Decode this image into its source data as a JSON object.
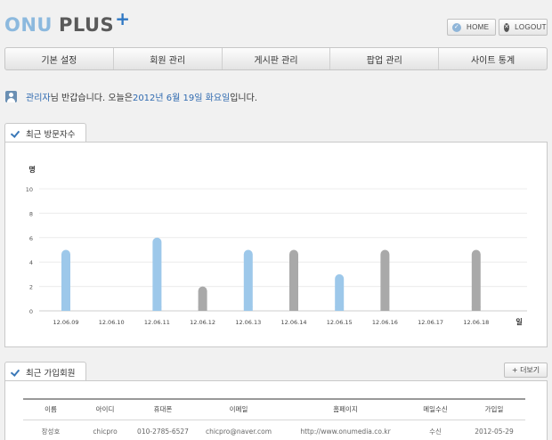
{
  "logo": {
    "onu": "ONU",
    "plus": "PLUS",
    "cross": "+"
  },
  "header": {
    "home_label": "HOME",
    "logout_label": "LOGOUT"
  },
  "nav": {
    "items": [
      "기본 설정",
      "회원 관리",
      "게시판 관리",
      "팝업 관리",
      "사이트 통계"
    ]
  },
  "welcome": {
    "user": "관리자",
    "text1": "님 반갑습니다. 오늘은 ",
    "date": "2012년 6월 19일 화요일",
    "text2": "입니다."
  },
  "visitors": {
    "tab_label": "최근 방문자수"
  },
  "chart_data": {
    "type": "bar",
    "ylabel": "명",
    "xlabel": "일",
    "ylim": [
      0,
      10
    ],
    "yticks": [
      0,
      2,
      4,
      6,
      8,
      10
    ],
    "grid": true,
    "categories": [
      "12.06.09",
      "12.06.10",
      "12.06.11",
      "12.06.12",
      "12.06.13",
      "12.06.14",
      "12.06.15",
      "12.06.16",
      "12.06.17",
      "12.06.18"
    ],
    "values": [
      5,
      0,
      6,
      2,
      5,
      5,
      3,
      5,
      0,
      5
    ],
    "colors": [
      "#9dc8ea",
      "#9dc8ea",
      "#9dc8ea",
      "#a9a9a9",
      "#9dc8ea",
      "#a9a9a9",
      "#9dc8ea",
      "#a9a9a9",
      "#a9a9a9",
      "#a9a9a9"
    ]
  },
  "members": {
    "tab_label": "최근 가입회원",
    "more_label": "+ 더보기",
    "columns": [
      "이름",
      "아이디",
      "휴대폰",
      "이메일",
      "홈페이지",
      "메일수신",
      "가입일"
    ],
    "rows": [
      [
        "장성호",
        "chicpro",
        "010-2785-6527",
        "chicpro@naver.com",
        "http://www.onumedia.co.kr",
        "수신",
        "2012-05-29"
      ]
    ]
  }
}
